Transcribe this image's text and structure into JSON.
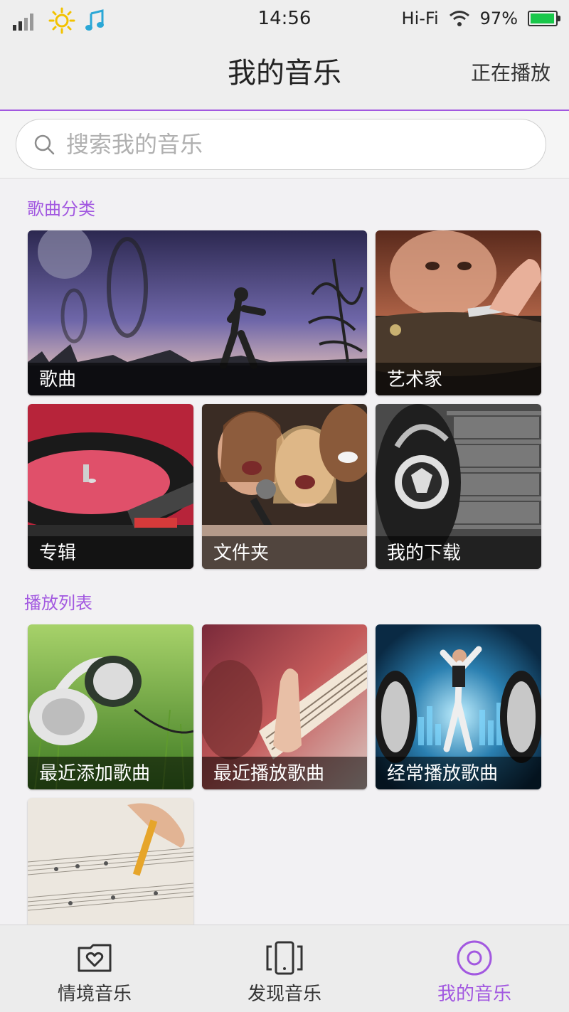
{
  "status_bar": {
    "time": "14:56",
    "network_label": "Hi-Fi",
    "battery": "97%",
    "battery_level": 0.97
  },
  "header": {
    "title": "我的音乐",
    "now_playing": "正在播放"
  },
  "search": {
    "placeholder": "搜索我的音乐"
  },
  "sections": [
    {
      "title": "歌曲分类",
      "items": [
        "歌曲",
        "艺术家",
        "专辑",
        "文件夹",
        "我的下载"
      ]
    },
    {
      "title": "播放列表",
      "items": [
        "最近添加歌曲",
        "最近播放歌曲",
        "经常播放歌曲"
      ]
    }
  ],
  "bottom_nav": {
    "tabs": [
      {
        "label": "情境音乐",
        "icon": "folder-heart-icon"
      },
      {
        "label": "发现音乐",
        "icon": "phone-icon"
      },
      {
        "label": "我的音乐",
        "icon": "record-icon",
        "active": true
      }
    ]
  },
  "colors": {
    "accent": "#a258e0",
    "battery": "#19c74a"
  }
}
